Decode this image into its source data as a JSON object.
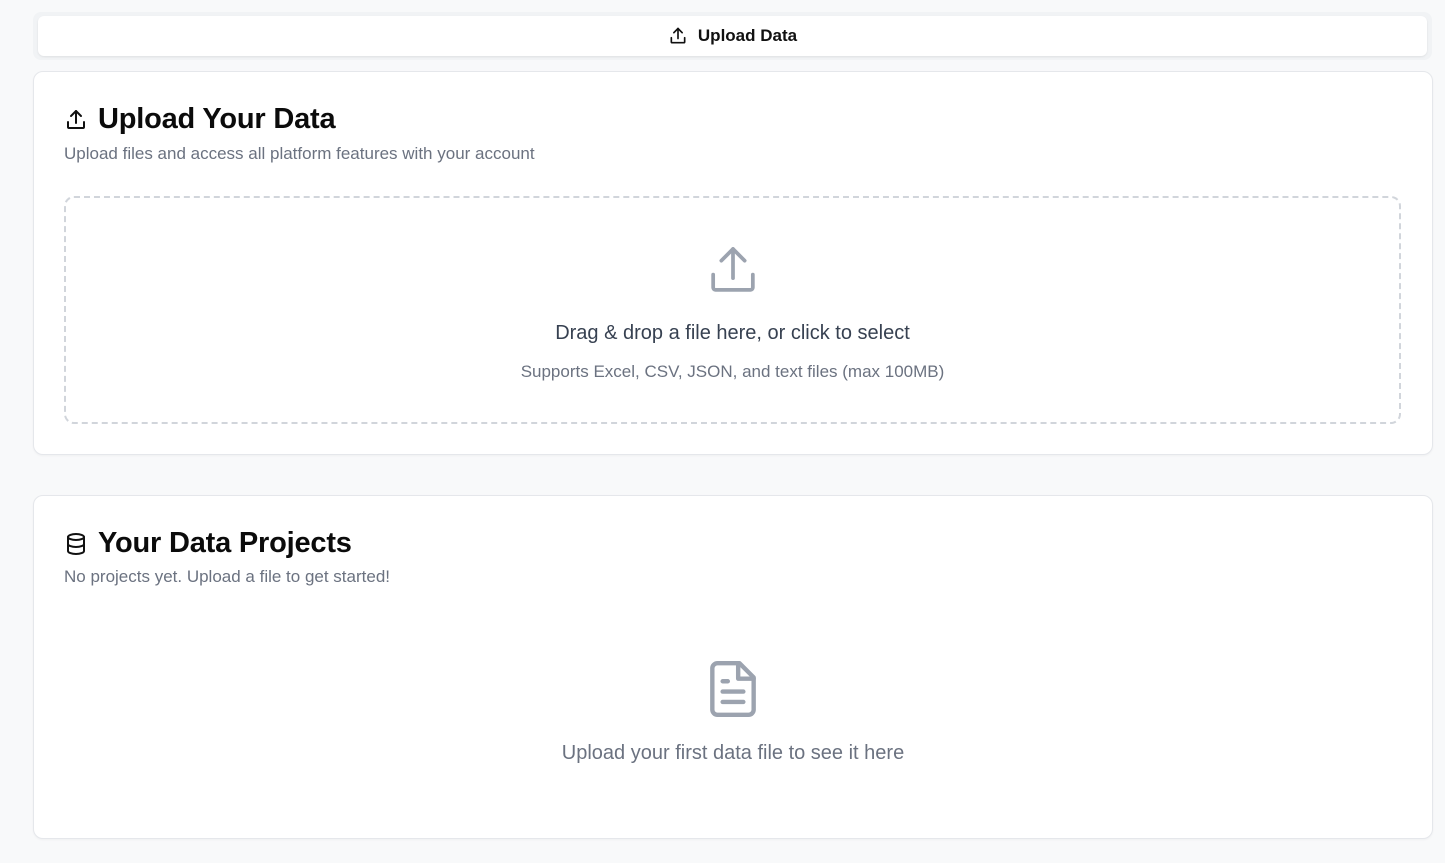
{
  "tabs": [
    {
      "label": "Upload Data",
      "icon": "upload-icon",
      "active": true
    }
  ],
  "upload_card": {
    "title": "Upload Your Data",
    "title_icon": "upload-icon",
    "description": "Upload files and access all platform features with your account",
    "dropzone": {
      "icon": "upload-icon",
      "primary_text": "Drag & drop a file here, or click to select",
      "secondary_text": "Supports Excel, CSV, JSON, and text files (max 100MB)"
    }
  },
  "projects_card": {
    "title": "Your Data Projects",
    "title_icon": "database-icon",
    "description": "No projects yet. Upload a file to get started!",
    "empty_state": {
      "icon": "file-text-icon",
      "text": "Upload your first data file to see it here"
    }
  },
  "colors": {
    "background": "#f8f9fa",
    "card": "#ffffff",
    "border": "#e5e7eb",
    "muted_text": "#6b7280",
    "icon_gray": "#9ca3af"
  }
}
